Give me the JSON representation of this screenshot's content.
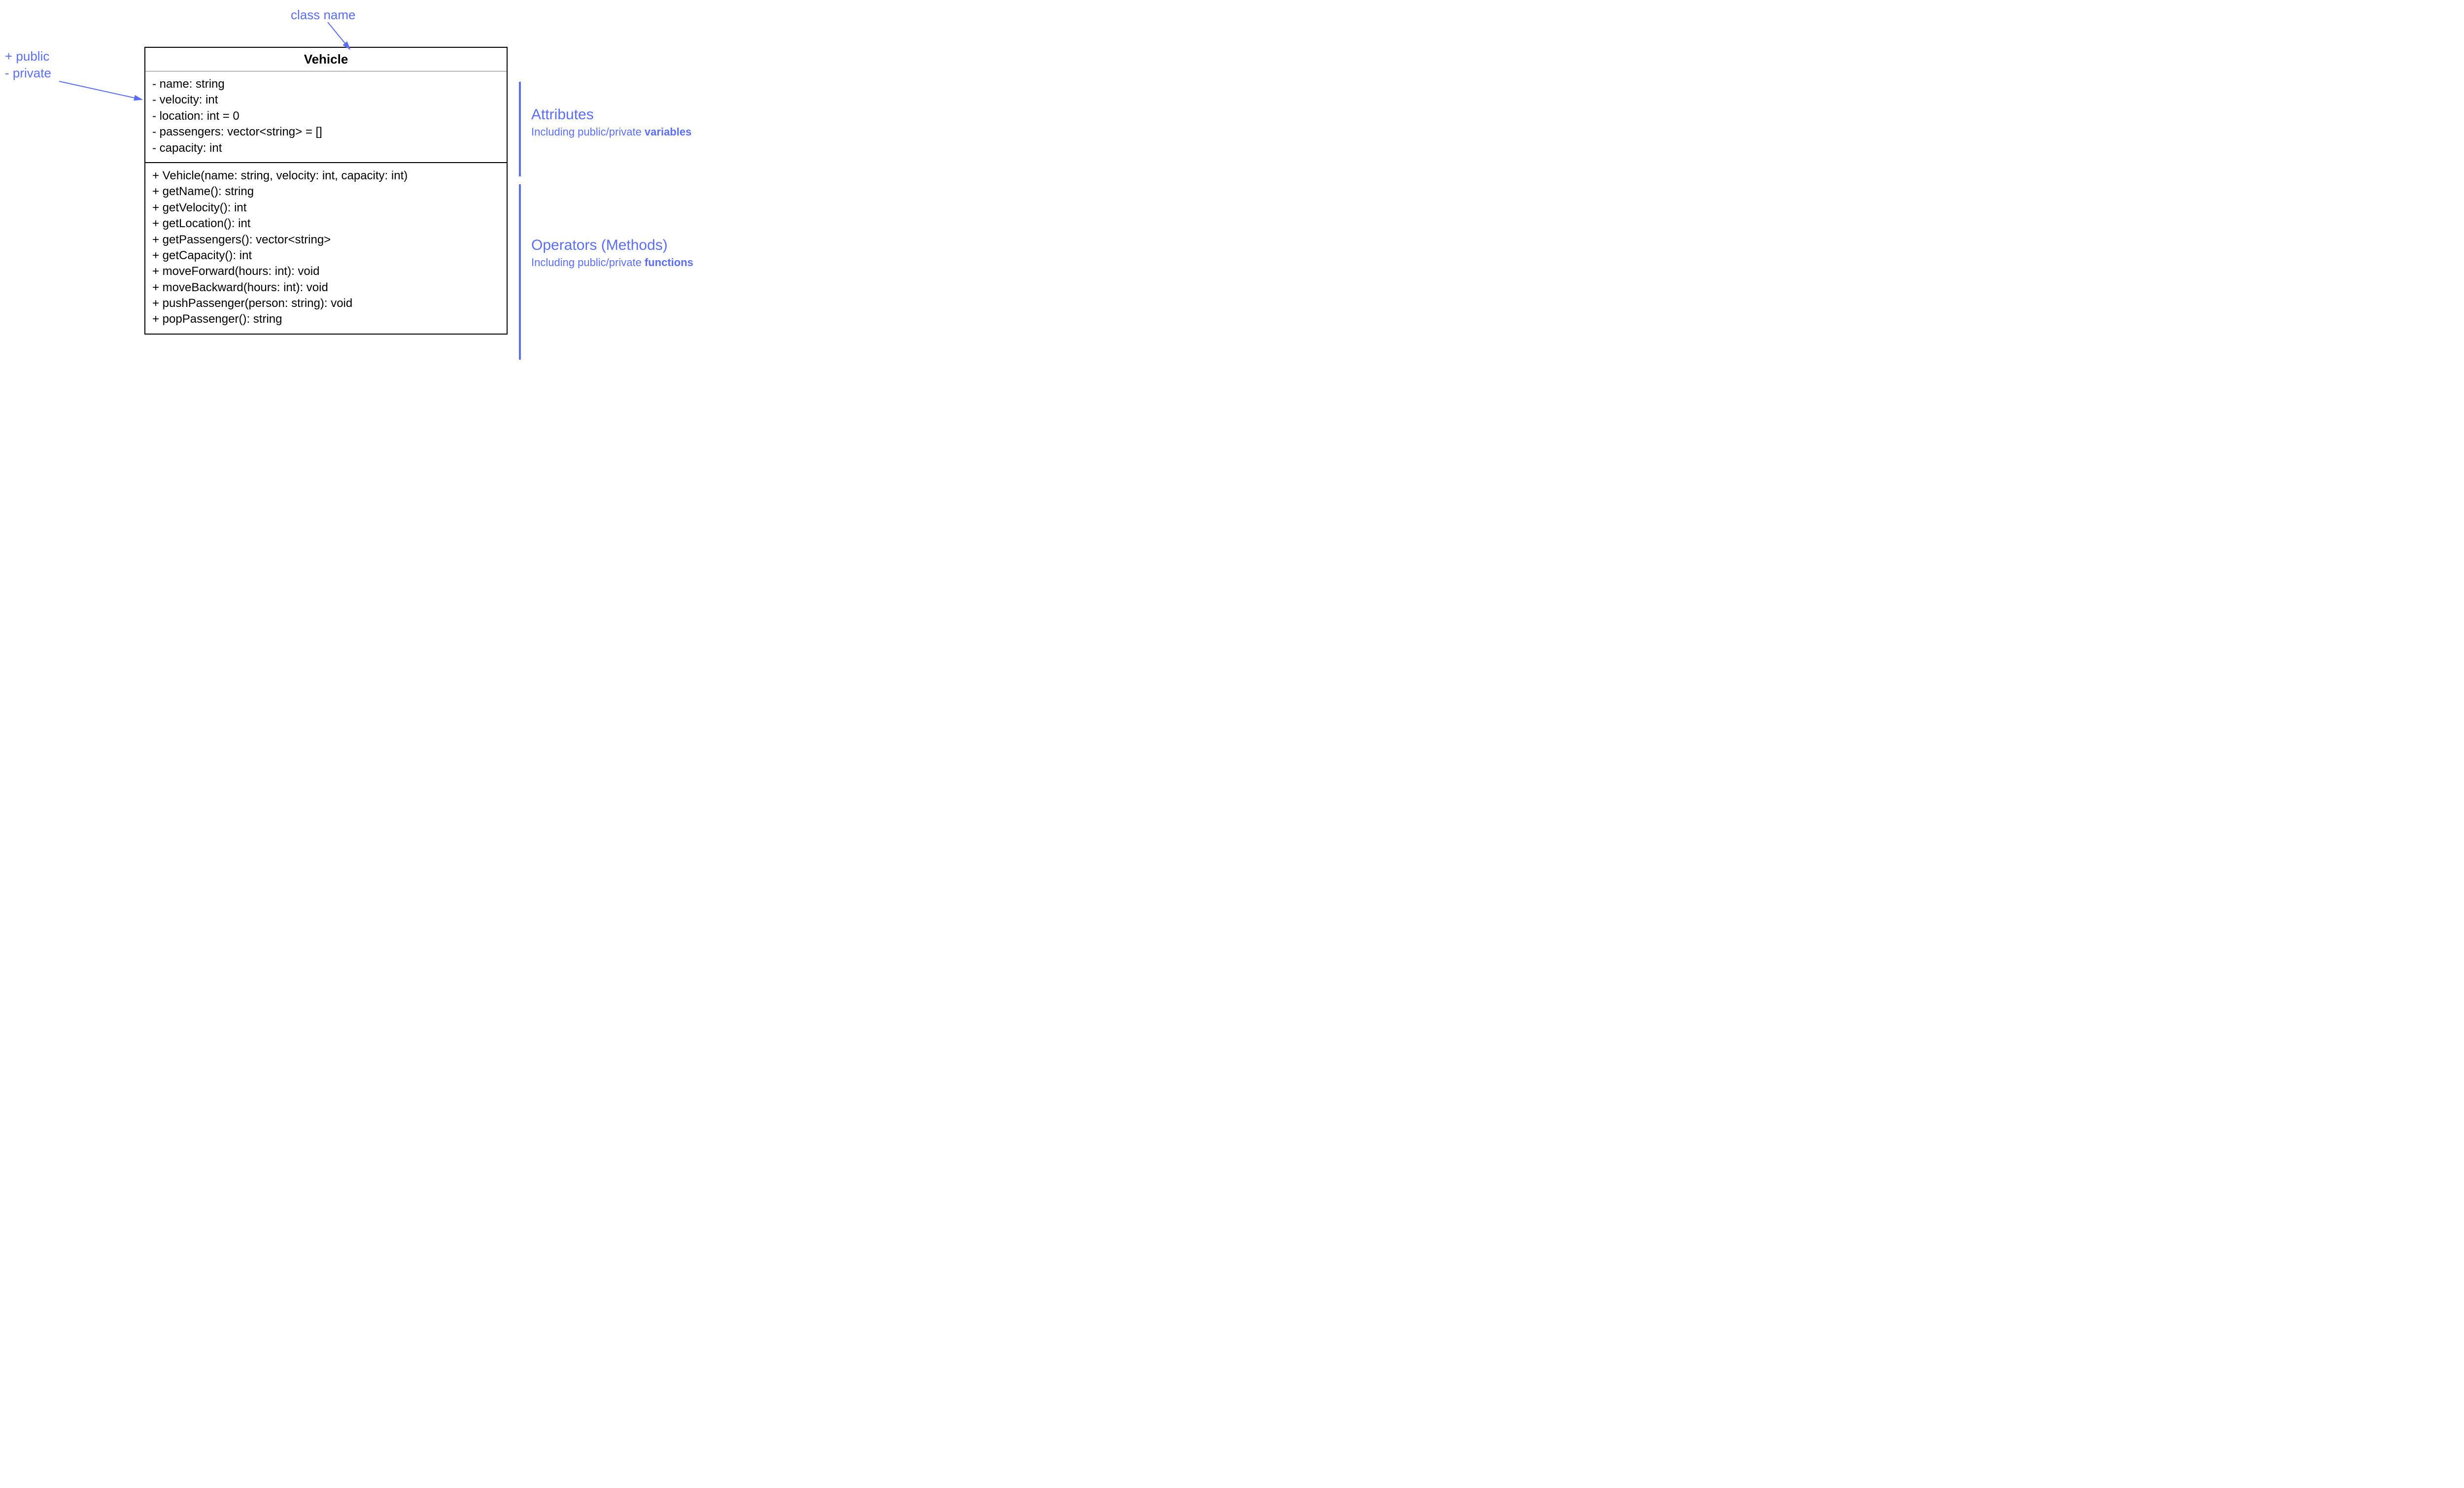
{
  "labels": {
    "class_name": "class name",
    "visibility_public": "+  public",
    "visibility_private": "-  private",
    "attributes_title": "Attributes",
    "attributes_sub_prefix": "Including public/private ",
    "attributes_sub_bold": "variables",
    "methods_title": "Operators (Methods)",
    "methods_sub_prefix": "Including public/private ",
    "methods_sub_bold": "functions"
  },
  "uml": {
    "class_name": "Vehicle",
    "attributes": [
      "- name: string",
      "- velocity: int",
      "- location: int = 0",
      "- passengers: vector<string> = []",
      "- capacity: int"
    ],
    "methods": [
      "+ Vehicle(name: string, velocity: int, capacity: int)",
      "+ getName(): string",
      "+ getVelocity(): int",
      "+ getLocation(): int",
      "+ getPassengers(): vector<string>",
      "+ getCapacity(): int",
      "+ moveForward(hours: int): void",
      "+ moveBackward(hours: int): void",
      "+ pushPassenger(person: string): void",
      "+ popPassenger(): string"
    ]
  }
}
